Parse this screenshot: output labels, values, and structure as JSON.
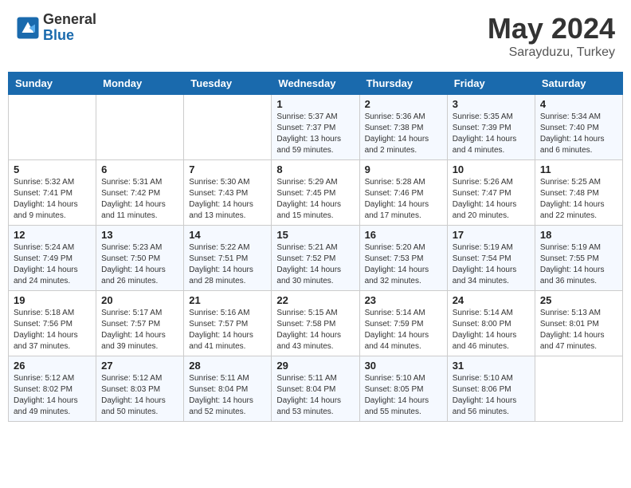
{
  "header": {
    "logo_general": "General",
    "logo_blue": "Blue",
    "month_year": "May 2024",
    "location": "Sarayduzu, Turkey"
  },
  "days_of_week": [
    "Sunday",
    "Monday",
    "Tuesday",
    "Wednesday",
    "Thursday",
    "Friday",
    "Saturday"
  ],
  "weeks": [
    {
      "days": [
        {
          "num": "",
          "info": ""
        },
        {
          "num": "",
          "info": ""
        },
        {
          "num": "",
          "info": ""
        },
        {
          "num": "1",
          "info": "Sunrise: 5:37 AM\nSunset: 7:37 PM\nDaylight: 13 hours\nand 59 minutes."
        },
        {
          "num": "2",
          "info": "Sunrise: 5:36 AM\nSunset: 7:38 PM\nDaylight: 14 hours\nand 2 minutes."
        },
        {
          "num": "3",
          "info": "Sunrise: 5:35 AM\nSunset: 7:39 PM\nDaylight: 14 hours\nand 4 minutes."
        },
        {
          "num": "4",
          "info": "Sunrise: 5:34 AM\nSunset: 7:40 PM\nDaylight: 14 hours\nand 6 minutes."
        }
      ]
    },
    {
      "days": [
        {
          "num": "5",
          "info": "Sunrise: 5:32 AM\nSunset: 7:41 PM\nDaylight: 14 hours\nand 9 minutes."
        },
        {
          "num": "6",
          "info": "Sunrise: 5:31 AM\nSunset: 7:42 PM\nDaylight: 14 hours\nand 11 minutes."
        },
        {
          "num": "7",
          "info": "Sunrise: 5:30 AM\nSunset: 7:43 PM\nDaylight: 14 hours\nand 13 minutes."
        },
        {
          "num": "8",
          "info": "Sunrise: 5:29 AM\nSunset: 7:45 PM\nDaylight: 14 hours\nand 15 minutes."
        },
        {
          "num": "9",
          "info": "Sunrise: 5:28 AM\nSunset: 7:46 PM\nDaylight: 14 hours\nand 17 minutes."
        },
        {
          "num": "10",
          "info": "Sunrise: 5:26 AM\nSunset: 7:47 PM\nDaylight: 14 hours\nand 20 minutes."
        },
        {
          "num": "11",
          "info": "Sunrise: 5:25 AM\nSunset: 7:48 PM\nDaylight: 14 hours\nand 22 minutes."
        }
      ]
    },
    {
      "days": [
        {
          "num": "12",
          "info": "Sunrise: 5:24 AM\nSunset: 7:49 PM\nDaylight: 14 hours\nand 24 minutes."
        },
        {
          "num": "13",
          "info": "Sunrise: 5:23 AM\nSunset: 7:50 PM\nDaylight: 14 hours\nand 26 minutes."
        },
        {
          "num": "14",
          "info": "Sunrise: 5:22 AM\nSunset: 7:51 PM\nDaylight: 14 hours\nand 28 minutes."
        },
        {
          "num": "15",
          "info": "Sunrise: 5:21 AM\nSunset: 7:52 PM\nDaylight: 14 hours\nand 30 minutes."
        },
        {
          "num": "16",
          "info": "Sunrise: 5:20 AM\nSunset: 7:53 PM\nDaylight: 14 hours\nand 32 minutes."
        },
        {
          "num": "17",
          "info": "Sunrise: 5:19 AM\nSunset: 7:54 PM\nDaylight: 14 hours\nand 34 minutes."
        },
        {
          "num": "18",
          "info": "Sunrise: 5:19 AM\nSunset: 7:55 PM\nDaylight: 14 hours\nand 36 minutes."
        }
      ]
    },
    {
      "days": [
        {
          "num": "19",
          "info": "Sunrise: 5:18 AM\nSunset: 7:56 PM\nDaylight: 14 hours\nand 37 minutes."
        },
        {
          "num": "20",
          "info": "Sunrise: 5:17 AM\nSunset: 7:57 PM\nDaylight: 14 hours\nand 39 minutes."
        },
        {
          "num": "21",
          "info": "Sunrise: 5:16 AM\nSunset: 7:57 PM\nDaylight: 14 hours\nand 41 minutes."
        },
        {
          "num": "22",
          "info": "Sunrise: 5:15 AM\nSunset: 7:58 PM\nDaylight: 14 hours\nand 43 minutes."
        },
        {
          "num": "23",
          "info": "Sunrise: 5:14 AM\nSunset: 7:59 PM\nDaylight: 14 hours\nand 44 minutes."
        },
        {
          "num": "24",
          "info": "Sunrise: 5:14 AM\nSunset: 8:00 PM\nDaylight: 14 hours\nand 46 minutes."
        },
        {
          "num": "25",
          "info": "Sunrise: 5:13 AM\nSunset: 8:01 PM\nDaylight: 14 hours\nand 47 minutes."
        }
      ]
    },
    {
      "days": [
        {
          "num": "26",
          "info": "Sunrise: 5:12 AM\nSunset: 8:02 PM\nDaylight: 14 hours\nand 49 minutes."
        },
        {
          "num": "27",
          "info": "Sunrise: 5:12 AM\nSunset: 8:03 PM\nDaylight: 14 hours\nand 50 minutes."
        },
        {
          "num": "28",
          "info": "Sunrise: 5:11 AM\nSunset: 8:04 PM\nDaylight: 14 hours\nand 52 minutes."
        },
        {
          "num": "29",
          "info": "Sunrise: 5:11 AM\nSunset: 8:04 PM\nDaylight: 14 hours\nand 53 minutes."
        },
        {
          "num": "30",
          "info": "Sunrise: 5:10 AM\nSunset: 8:05 PM\nDaylight: 14 hours\nand 55 minutes."
        },
        {
          "num": "31",
          "info": "Sunrise: 5:10 AM\nSunset: 8:06 PM\nDaylight: 14 hours\nand 56 minutes."
        },
        {
          "num": "",
          "info": ""
        }
      ]
    }
  ]
}
